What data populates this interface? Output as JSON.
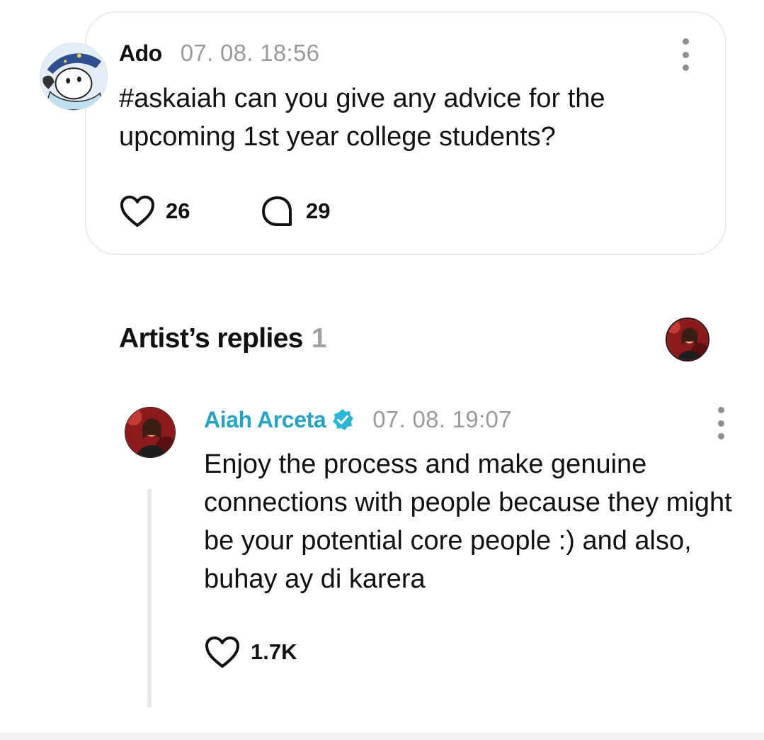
{
  "post": {
    "author": "Ado",
    "timestamp": "07. 08. 18:56",
    "text": "#askaiah can you give any advice for the upcoming 1st year college students?",
    "likes": "26",
    "comments": "29"
  },
  "replies_section": {
    "title": "Artist’s replies",
    "count": "1"
  },
  "reply": {
    "author": "Aiah Arceta",
    "timestamp": "07. 08. 19:07",
    "text": "Enjoy the process and make genuine connections with people because they might be your potential core people :) and also, buhay ay di karera",
    "likes": "1.7K"
  },
  "colors": {
    "artist_name": "#2aa3c3",
    "verified_badge": "#2bb6d3",
    "muted_text": "#9a9a9a",
    "card_border": "#ebebeb"
  },
  "icons": {
    "like": "heart-outline-icon",
    "comment": "speech-bubble-icon",
    "more": "vertical-ellipsis-icon",
    "verified": "verified-badge-icon"
  }
}
